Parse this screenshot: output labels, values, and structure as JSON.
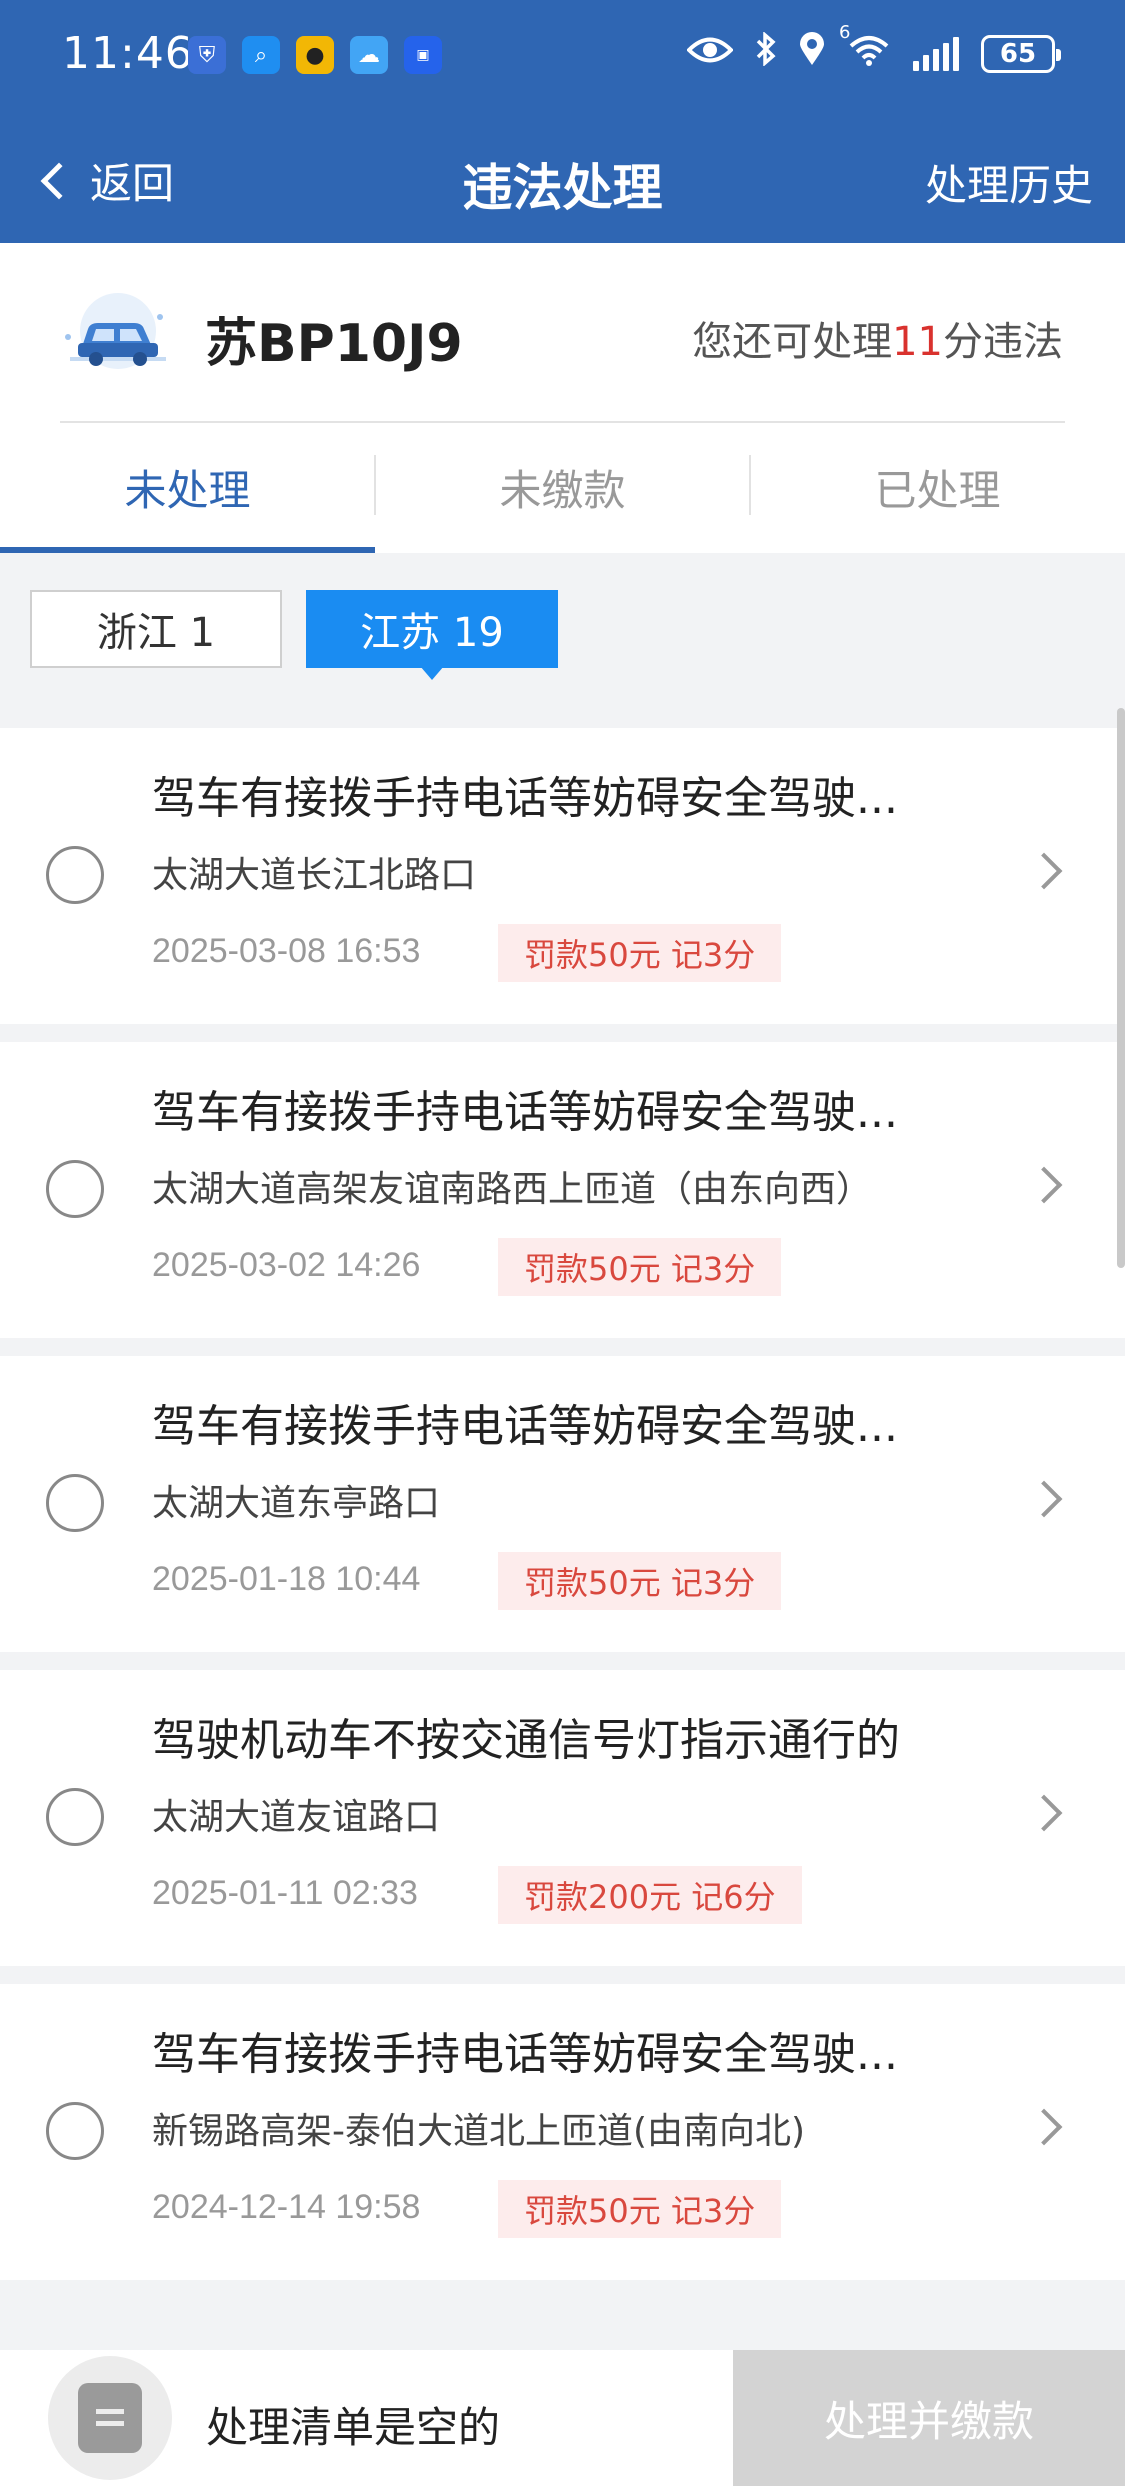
{
  "status_bar": {
    "time": "11:46",
    "network": "6",
    "battery": "65",
    "app_icons": [
      {
        "name": "shield-app-icon",
        "color": "#3b6fd6"
      },
      {
        "name": "search-app-icon",
        "color": "#1f8ef1"
      },
      {
        "name": "car-app-icon",
        "color": "#f2b705"
      },
      {
        "name": "weather-app-icon",
        "color": "#42a5f5"
      },
      {
        "name": "autohome-app-icon",
        "color": "#2563eb"
      }
    ]
  },
  "nav": {
    "back_label": "返回",
    "title": "违法处理",
    "history_label": "处理历史"
  },
  "vehicle": {
    "plate": "苏BP10J9",
    "quota_prefix": "您还可处理",
    "quota_value": "11",
    "quota_suffix": "分违法"
  },
  "tabs": [
    {
      "label": "未处理",
      "active": true
    },
    {
      "label": "未缴款",
      "active": false
    },
    {
      "label": "已处理",
      "active": false
    }
  ],
  "province_filters": [
    {
      "label": "浙江 1",
      "active": false
    },
    {
      "label": "江苏 19",
      "active": true
    }
  ],
  "violations": [
    {
      "title": "驾车有接拨手持电话等妨碍安全驾驶...",
      "location": "太湖大道长江北路口",
      "datetime": "2025-03-08 16:53",
      "penalty": "罚款50元 记3分"
    },
    {
      "title": "驾车有接拨手持电话等妨碍安全驾驶...",
      "location": "太湖大道高架友谊南路西上匝道（由东向西）",
      "datetime": "2025-03-02 14:26",
      "penalty": "罚款50元 记3分"
    },
    {
      "title": "驾车有接拨手持电话等妨碍安全驾驶...",
      "location": "太湖大道东亭路口",
      "datetime": "2025-01-18 10:44",
      "penalty": "罚款50元 记3分"
    },
    {
      "title": "驾驶机动车不按交通信号灯指示通行的",
      "location": "太湖大道友谊路口",
      "datetime": "2025-01-11 02:33",
      "penalty": "罚款200元 记6分"
    },
    {
      "title": "驾车有接拨手持电话等妨碍安全驾驶...",
      "location": "新锡路高架-泰伯大道北上匝道(由南向北)",
      "datetime": "2024-12-14 19:58",
      "penalty": "罚款50元 记3分"
    }
  ],
  "bottom": {
    "cart_status": "处理清单是空的",
    "pay_button": "处理并缴款"
  },
  "colors": {
    "header_bg": "#2f66b3",
    "accent": "#1a8cf2",
    "danger": "#d9322e",
    "badge_bg": "#fdecec"
  }
}
